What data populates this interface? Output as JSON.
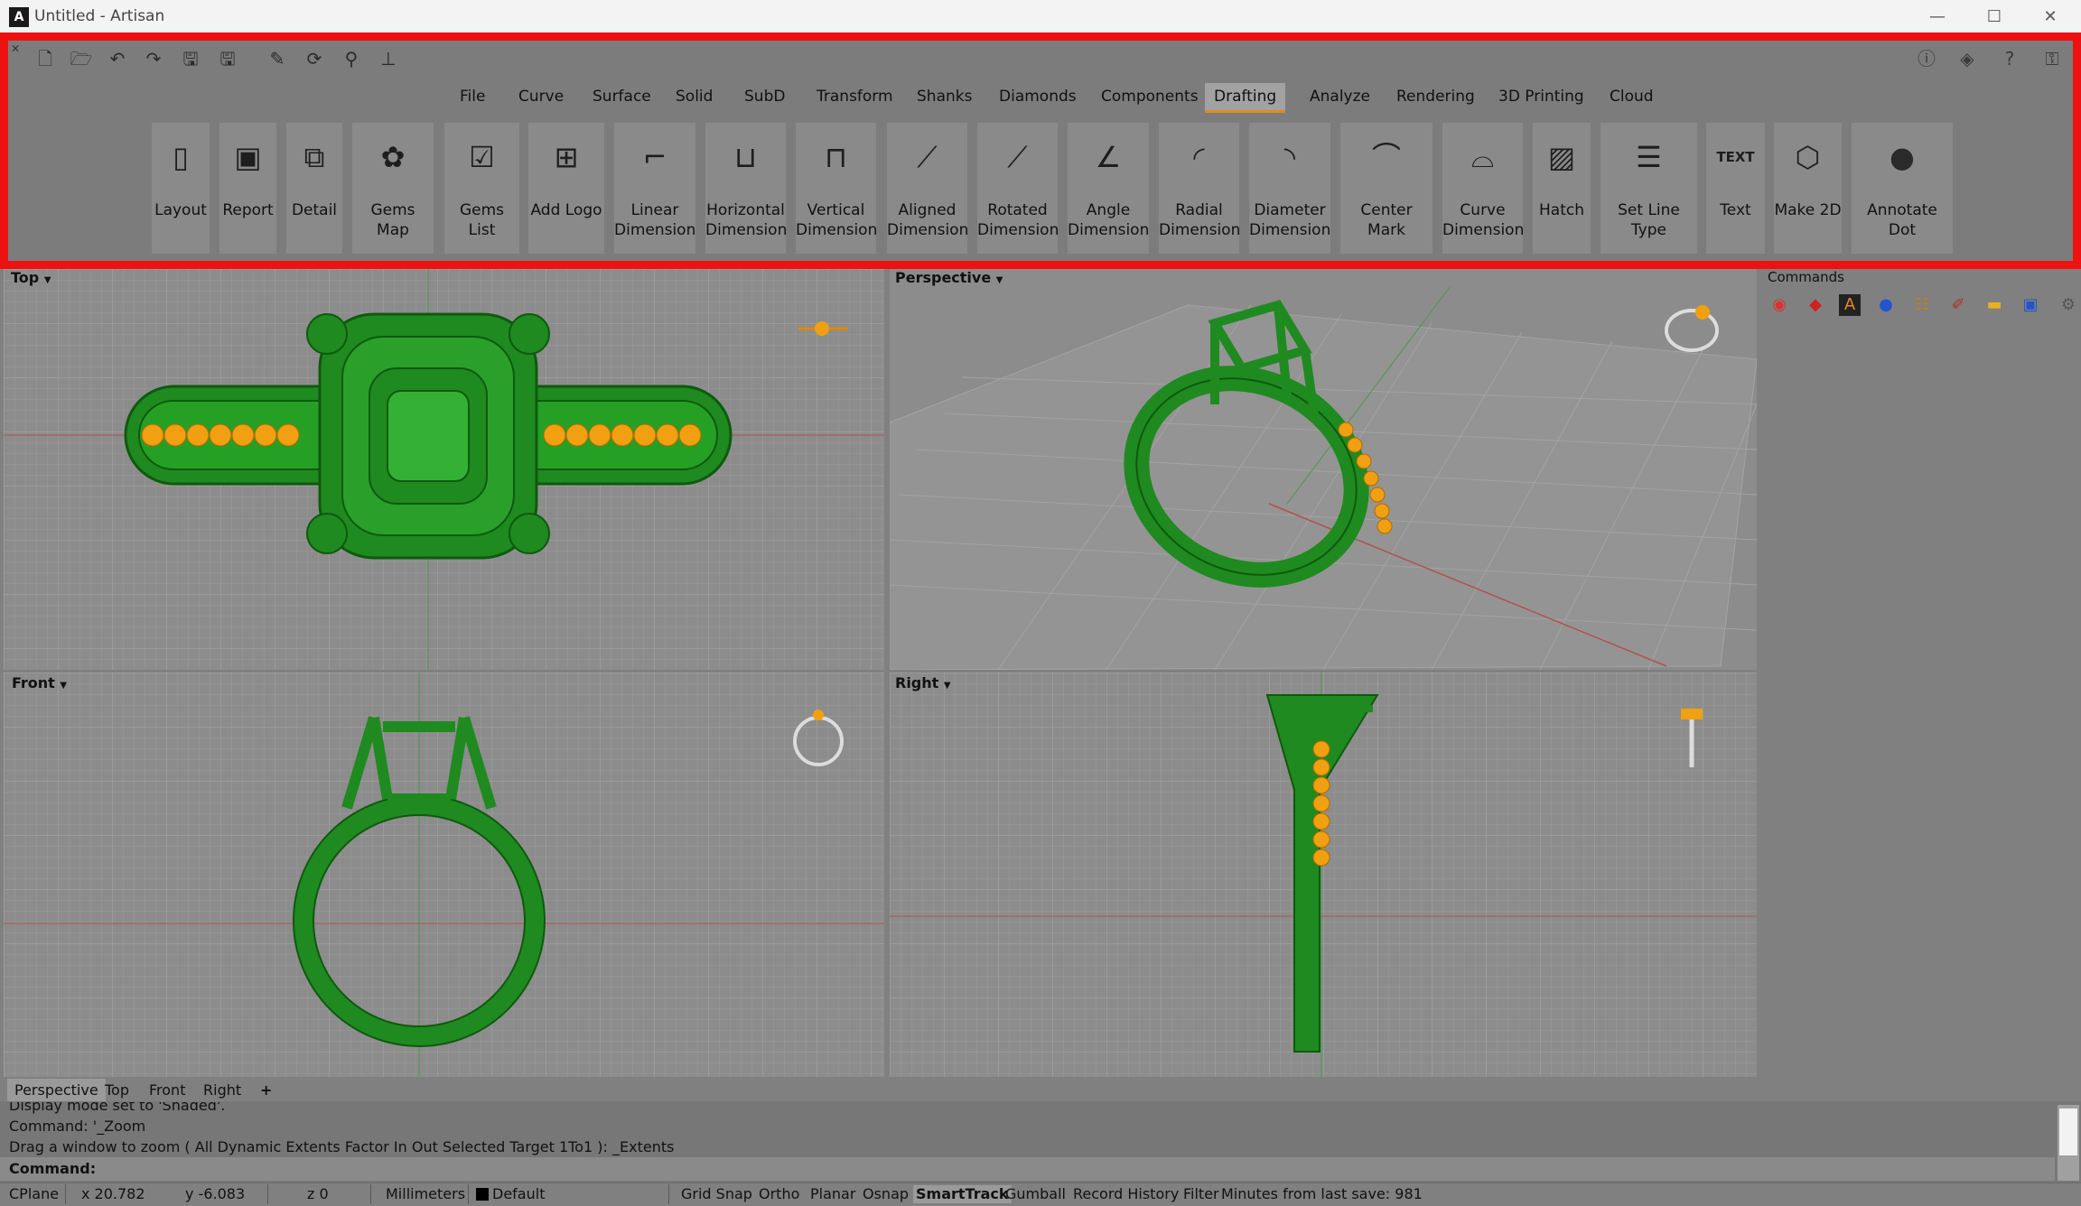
{
  "window": {
    "title": "Untitled - Artisan",
    "logo": "A",
    "minimize": "—",
    "maximize": "☐",
    "close": "✕"
  },
  "quick_access": [
    "new-file-icon",
    "open-file-icon",
    "undo-icon",
    "redo-icon",
    "save-icon",
    "save-as-icon",
    "draw-icon",
    "select-icon",
    "wand-icon",
    "deselect-icon"
  ],
  "right_icons": [
    "info-icon",
    "layers-icon",
    "help-icon",
    "key-icon"
  ],
  "menu": {
    "tabs": [
      "File",
      "Curve",
      "Surface",
      "Solid",
      "SubD",
      "Transform",
      "Shanks",
      "Diamonds",
      "Components",
      "Drafting",
      "Analyze",
      "Rendering",
      "3D Printing",
      "Cloud"
    ],
    "active": "Drafting"
  },
  "ribbon": [
    {
      "label1": "Layout",
      "label2": "",
      "icon": "▯"
    },
    {
      "label1": "Report",
      "label2": "",
      "icon": "▣"
    },
    {
      "label1": "Detail",
      "label2": "",
      "icon": "⧉"
    },
    {
      "label1": "Gems Map",
      "label2": "",
      "icon": "✿"
    },
    {
      "label1": "Gems List",
      "label2": "",
      "icon": "☑"
    },
    {
      "label1": "Add Logo",
      "label2": "",
      "icon": "⊞"
    },
    {
      "label1": "Linear",
      "label2": "Dimension",
      "icon": "⌐"
    },
    {
      "label1": "Horizontal",
      "label2": "Dimension",
      "icon": "⊔"
    },
    {
      "label1": "Vertical",
      "label2": "Dimension",
      "icon": "⊓"
    },
    {
      "label1": "Aligned",
      "label2": "Dimension",
      "icon": "⟋"
    },
    {
      "label1": "Rotated",
      "label2": "Dimension",
      "icon": "⟋"
    },
    {
      "label1": "Angle",
      "label2": "Dimension",
      "icon": "∠"
    },
    {
      "label1": "Radial",
      "label2": "Dimension",
      "icon": "◜"
    },
    {
      "label1": "Diameter",
      "label2": "Dimension",
      "icon": "◝"
    },
    {
      "label1": "Center Mark",
      "label2": "",
      "icon": "⌒"
    },
    {
      "label1": "Curve",
      "label2": "Dimension",
      "icon": "⌓"
    },
    {
      "label1": "Hatch",
      "label2": "",
      "icon": "▨"
    },
    {
      "label1": "Set Line Type",
      "label2": "",
      "icon": "☰"
    },
    {
      "label1": "Text",
      "label2": "",
      "icon": "TEXT"
    },
    {
      "label1": "Make 2D",
      "label2": "",
      "icon": "⬡"
    },
    {
      "label1": "Annotate Dot",
      "label2": "",
      "icon": "●"
    }
  ],
  "viewports": {
    "top": "Top",
    "perspective": "Perspective",
    "front": "Front",
    "right": "Right",
    "dropdown": "▼"
  },
  "right_panel": {
    "title": "Commands",
    "icons": [
      "color-wheel-icon",
      "materials-icon",
      "artisan-icon",
      "render-icon",
      "layers-tree-icon",
      "brush-icon",
      "folder-icon",
      "display-icon",
      "settings-icon"
    ]
  },
  "viewport_tabs": [
    "Perspective",
    "Top",
    "Front",
    "Right",
    "+"
  ],
  "command": {
    "history": [
      "Display mode set to 'Shaded'.",
      "Command: '_Zoom",
      "Drag a window to zoom ( All  Dynamic  Extents  Factor  In  Out  Selected  Target  1To1 ): _Extents"
    ],
    "prompt": "Command:"
  },
  "status": {
    "cplane": "CPlane",
    "x": "x 20.782",
    "y": "y -6.083",
    "z": "z 0",
    "units": "Millimeters",
    "layer": "Default",
    "toggles": [
      "Grid Snap",
      "Ortho",
      "Planar",
      "Osnap",
      "SmartTrack",
      "Gumball",
      "Record History",
      "Filter"
    ],
    "active_toggle": "SmartTrack",
    "save_info": "Minutes from last save: 981"
  },
  "colors": {
    "ring_green": "#1f9a1f",
    "gem_orange": "#f0a010",
    "accent": "#e58a1f",
    "highlight": "#ee1111"
  }
}
